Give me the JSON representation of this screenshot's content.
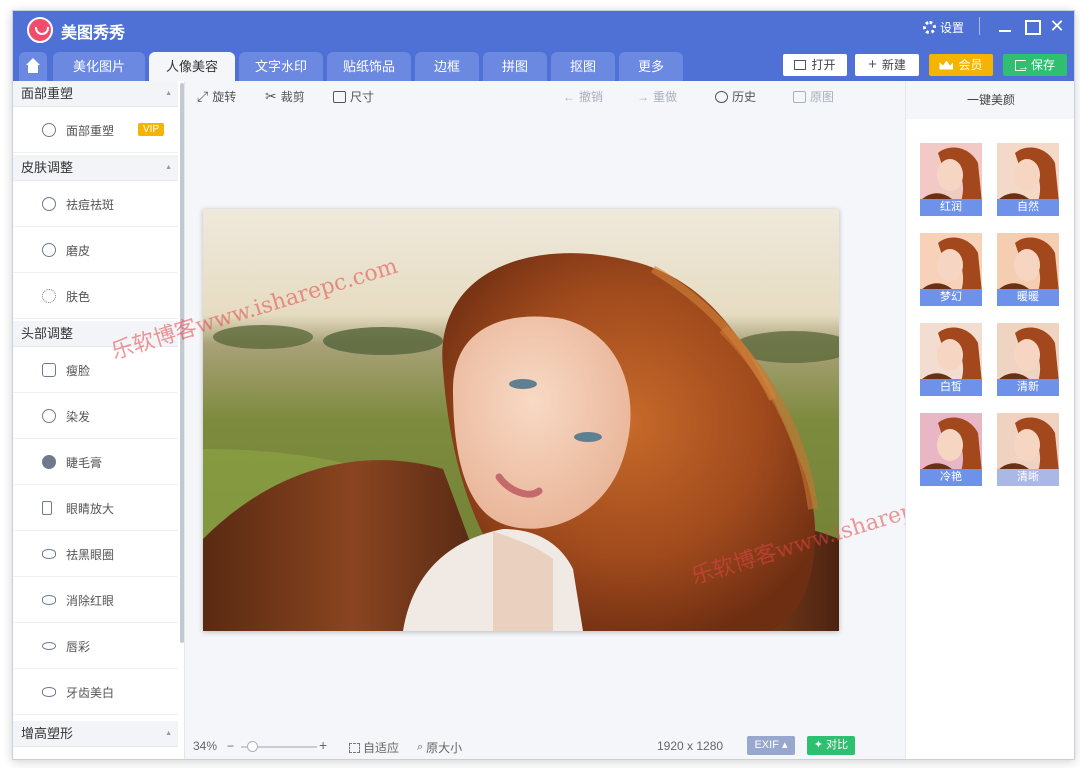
{
  "app": {
    "title": "美图秀秀"
  },
  "titlebar": {
    "settings_label": "设置"
  },
  "tabs": [
    "美化图片",
    "人像美容",
    "文字水印",
    "贴纸饰品",
    "边框",
    "拼图",
    "抠图",
    "更多"
  ],
  "active_tab": "人像美容",
  "actions": {
    "open": "打开",
    "new": "新建",
    "vip": "会员",
    "save": "保存"
  },
  "sidebar": {
    "sections": [
      {
        "title": "面部重塑",
        "items": [
          {
            "label": "面部重塑",
            "badge": "VIP"
          }
        ]
      },
      {
        "title": "皮肤调整",
        "items": [
          {
            "label": "祛痘祛斑"
          },
          {
            "label": "磨皮"
          },
          {
            "label": "肤色"
          }
        ]
      },
      {
        "title": "头部调整",
        "items": [
          {
            "label": "瘦脸"
          },
          {
            "label": "染发"
          },
          {
            "label": "睫毛膏"
          },
          {
            "label": "眼睛放大"
          },
          {
            "label": "祛黑眼圈"
          },
          {
            "label": "消除红眼"
          },
          {
            "label": "唇彩"
          },
          {
            "label": "牙齿美白"
          }
        ]
      },
      {
        "title": "增高塑形",
        "items": []
      }
    ]
  },
  "toolbar": {
    "rotate": "旋转",
    "crop": "裁剪",
    "size": "尺寸",
    "undo": "撤销",
    "redo": "重做",
    "history": "历史",
    "original": "原图"
  },
  "watermark": {
    "left": "乐软博客www.isharepc.com",
    "right": "乐软博客www.isharepc.com"
  },
  "statusbar": {
    "zoom": "34%",
    "zoom_level": 0.34,
    "zoom_minus": "−",
    "zoom_plus": "+",
    "fit": "自适应",
    "actual": "原大小",
    "dimensions": "1920 x 1280",
    "exif": "EXIF",
    "compare": "对比"
  },
  "right_panel": {
    "title": "一键美颜",
    "presets": [
      "红润",
      "自然",
      "梦幻",
      "暖暖",
      "白皙",
      "清新",
      "冷艳",
      "清晰"
    ]
  },
  "colors": {
    "brand_blue": "#4f71d6",
    "vip_gold": "#f5b400",
    "save_green": "#2fbf71",
    "preset_label": "#6e92ea"
  }
}
